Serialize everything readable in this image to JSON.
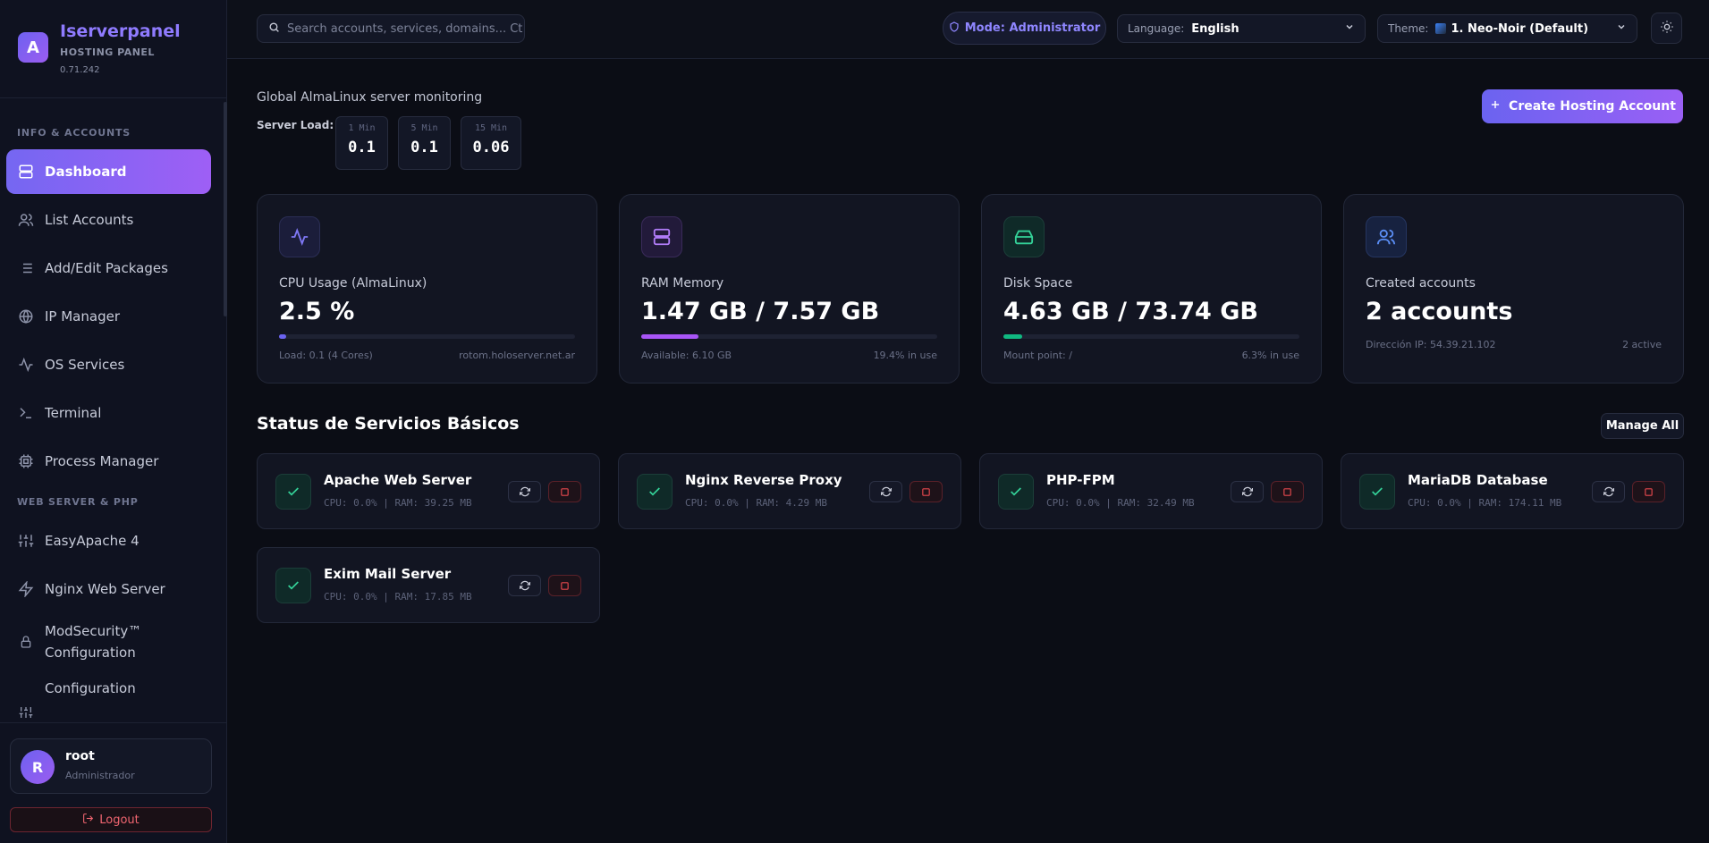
{
  "brand": {
    "logo_letter": "A",
    "name": "Iserverpanel",
    "subtitle": "HOSTING PANEL",
    "version": "0.71.242"
  },
  "sidebar": {
    "sections": [
      {
        "label": "INFO & ACCOUNTS"
      },
      {
        "label": "WEB SERVER & PHP"
      }
    ],
    "items": [
      {
        "label": "Dashboard",
        "icon": "server-icon",
        "active": true
      },
      {
        "label": "List Accounts",
        "icon": "users-icon"
      },
      {
        "label": "Add/Edit Packages",
        "icon": "list-icon"
      },
      {
        "label": "IP Manager",
        "icon": "globe-icon"
      },
      {
        "label": "OS Services",
        "icon": "activity-icon"
      },
      {
        "label": "Terminal",
        "icon": "terminal-icon"
      },
      {
        "label": "Process Manager",
        "icon": "cpu-icon"
      },
      {
        "label": "EasyApache 4",
        "icon": "sliders-icon"
      },
      {
        "label": "Nginx Web Server",
        "icon": "bolt-icon"
      },
      {
        "label": "ModSecurity™ Configuration",
        "icon": "lock-icon"
      },
      {
        "label": "Configuration",
        "icon": "sliders-icon"
      }
    ],
    "user": {
      "initial": "R",
      "name": "root",
      "role": "Administrador"
    },
    "logout_label": "Logout"
  },
  "topbar": {
    "search_placeholder": "Search accounts, services, domains... Ct",
    "mode_label": "Mode: Administrator",
    "language": {
      "label": "Language:",
      "value": "English"
    },
    "theme": {
      "label": "Theme:",
      "value": "1. Neo-Noir (Default)"
    }
  },
  "monitor": {
    "title": "Global AlmaLinux server monitoring",
    "load_label": "Server Load:",
    "loads": [
      {
        "label": "1 Min",
        "value": "0.1"
      },
      {
        "label": "5 Min",
        "value": "0.1"
      },
      {
        "label": "15 Min",
        "value": "0.06"
      }
    ],
    "create_label": "Create Hosting Account"
  },
  "stats": [
    {
      "title": "CPU Usage (AlmaLinux)",
      "value": "2.5 %",
      "foot_left": "Load: 0.1 (4 Cores)",
      "foot_right": "rotom.holoserver.net.ar",
      "percent": 2.5,
      "color": "#6b63f0",
      "icon": "activity-icon"
    },
    {
      "title": "RAM Memory",
      "value": "1.47 GB / 7.57 GB",
      "foot_left": "Available: 6.10 GB",
      "foot_right": "19.4% in use",
      "percent": 19.4,
      "color": "#a855f7",
      "icon": "server-icon"
    },
    {
      "title": "Disk Space",
      "value": "4.63 GB / 73.74 GB",
      "foot_left": "Mount point: /",
      "foot_right": "6.3% in use",
      "percent": 6.3,
      "color": "#10b981",
      "icon": "hard-drive-icon"
    },
    {
      "title": "Created accounts",
      "value": "2 accounts",
      "foot_left": "Dirección IP: 54.39.21.102",
      "foot_right": "2 active",
      "icon": "users-icon"
    }
  ],
  "services": {
    "title": "Status de Servicios Básicos",
    "manage_all_label": "Manage All",
    "items": [
      {
        "name": "Apache Web Server",
        "meta": "CPU: 0.0% | RAM: 39.25 MB"
      },
      {
        "name": "Nginx Reverse Proxy",
        "meta": "CPU: 0.0% | RAM: 4.29 MB"
      },
      {
        "name": "PHP-FPM",
        "meta": "CPU: 0.0% | RAM: 32.49 MB"
      },
      {
        "name": "MariaDB Database",
        "meta": "CPU: 0.0% | RAM: 174.11 MB"
      },
      {
        "name": "Exim Mail Server",
        "meta": "CPU: 0.0% | RAM: 17.85 MB"
      }
    ]
  }
}
